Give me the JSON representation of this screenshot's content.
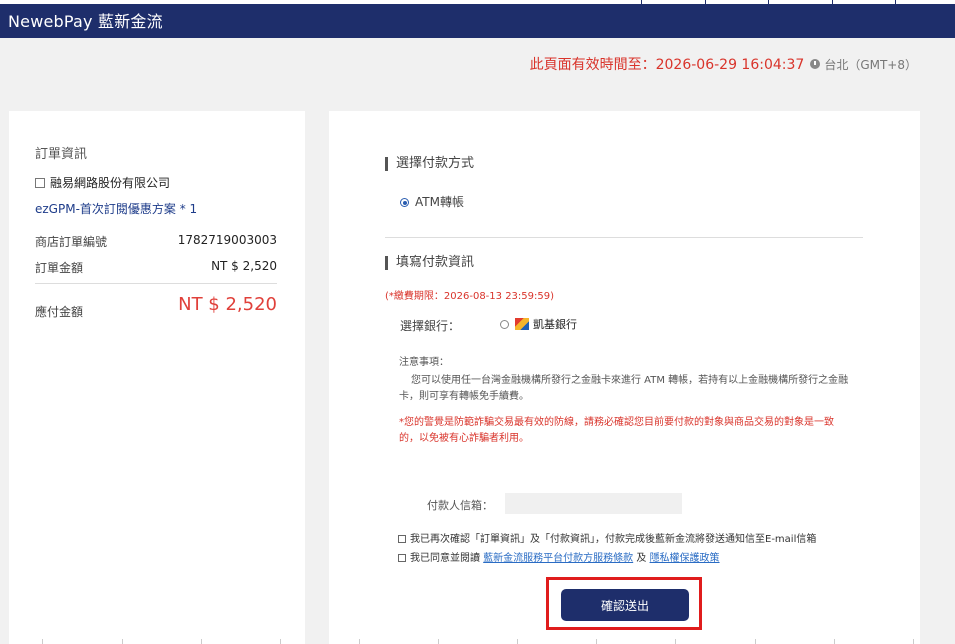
{
  "header": {
    "logo": "NewebPay 藍新金流"
  },
  "timer": {
    "text": "此頁面有效時間至：2026-06-29 16:04:37",
    "timezone": "台北（GMT+8）"
  },
  "order": {
    "title": "訂單資訊",
    "merchant": "融易網路股份有限公司",
    "product": "ezGPM-首次訂閱優惠方案 * 1",
    "order_no_label": "商店訂單編號",
    "order_no": "1782719003003",
    "amount_label": "訂單金額",
    "amount": "NT $ 2,520",
    "total_label": "應付金額",
    "total": "NT $ 2,520"
  },
  "payment": {
    "method_title": "選擇付款方式",
    "method_option": "ATM轉帳",
    "info_title": "填寫付款資訊",
    "deadline": "(*繳費期限：2026-08-13 23:59:59)",
    "bank_label": "選擇銀行：",
    "bank_name": "凱基銀行",
    "notes_title": "注意事項：",
    "notes_line1": "您可以使用任一台灣金融機構所發行之金融卡來進行 ATM 轉帳，若持有以上金融機構所發行之金融",
    "notes_line2": "卡，則可享有轉帳免手續費。",
    "warning": "*您的警覺是防範詐騙交易最有效的防線，請務必確認您目前要付款的對象與商品交易的對象是一致的，以免被有心詐騙者利用。",
    "email_label": "付款人信箱：",
    "email_value": "",
    "confirm_text": "我已再次確認「訂單資訊」及「付款資訊」，付款完成後藍新金流將發送通知信至E-mail信箱",
    "agree_prefix": "我已同意並閱讀",
    "terms_link": "藍新金流服務平台付款方服務條款",
    "agree_and": "及",
    "privacy_link": "隱私權保護政策",
    "submit": "確認送出"
  },
  "colors": {
    "brand": "#1e2e6b",
    "alert": "#d9342b",
    "link": "#2a6cc4",
    "highlight": "#e01c1c"
  }
}
